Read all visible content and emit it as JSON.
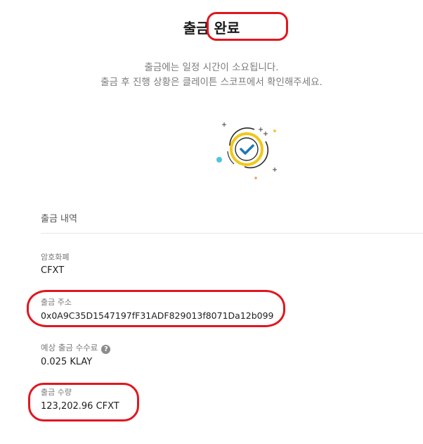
{
  "header": {
    "title": "출금 완료",
    "message_line1": "출금에는 일정 시간이 소요됩니다.",
    "message_line2": "출금 후 진행 상황은 클레이튼 스코프에서 확인해주세요."
  },
  "details": {
    "section_title": "출금 내역",
    "currency_label": "암호화폐",
    "currency_value": "CFXT",
    "address_label": "출금 주소",
    "address_value": "0x0A9C35D1547197fF31ADF829013f8071Da12b099",
    "fee_label": "예상 출금 수수료",
    "fee_value": "0.025 KLAY",
    "amount_label": "출금 수량",
    "amount_value": "123,202.96 CFXT"
  },
  "icons": {
    "success": "check-circle-icon",
    "help": "question-mark-icon"
  },
  "colors": {
    "accent_yellow": "#f1c81b",
    "check_blue": "#1e77b8",
    "annotation_red": "#e0171f",
    "dot_cyan": "#4fc3e0",
    "dot_orange": "#f29a63"
  }
}
